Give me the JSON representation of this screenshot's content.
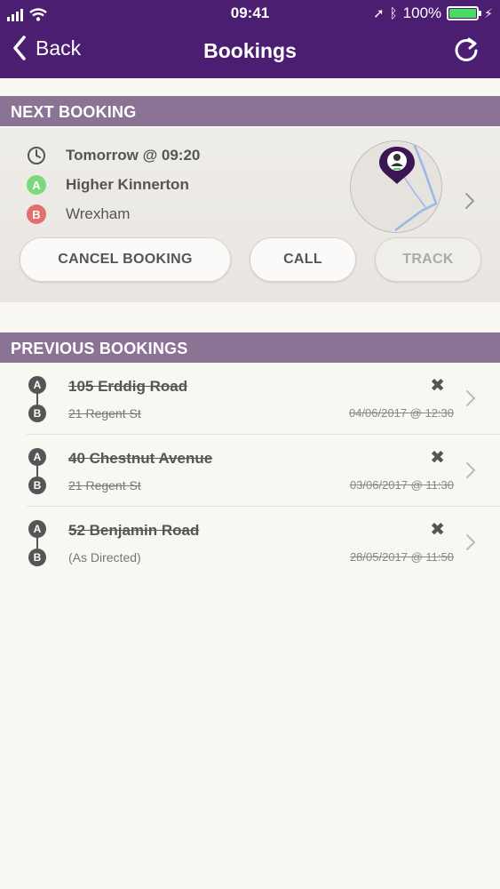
{
  "status_bar": {
    "time": "09:41",
    "battery": "100%"
  },
  "nav": {
    "back_label": "Back",
    "title": "Bookings"
  },
  "next_booking": {
    "header": "NEXT BOOKING",
    "time": "Tomorrow @ 09:20",
    "pickup": "Higher Kinnerton",
    "dropoff": "Wrexham",
    "pin_a": "A",
    "pin_b": "B",
    "buttons": {
      "cancel": "CANCEL BOOKING",
      "call": "CALL",
      "track": "TRACK"
    },
    "colors": {
      "a": "#7cd87a",
      "b": "#e36e6e"
    }
  },
  "previous_bookings": {
    "header": "PREVIOUS BOOKINGS",
    "items": [
      {
        "from": "105 Erddig Road",
        "to": "21 Regent St",
        "date": "04/06/2017 @ 12:30",
        "status_icon": "x-mark-icon"
      },
      {
        "from": "40 Chestnut Avenue",
        "to": "21 Regent St",
        "date": "03/06/2017 @ 11:30",
        "status_icon": "x-mark-icon"
      },
      {
        "from": "52 Benjamin Road",
        "to": "(As Directed)",
        "date": "28/05/2017 @ 11:50",
        "status_icon": "x-mark-icon"
      }
    ]
  },
  "theme": {
    "primary": "#4b1e72",
    "section": "#8b7396",
    "background": "#f9f7f2"
  }
}
